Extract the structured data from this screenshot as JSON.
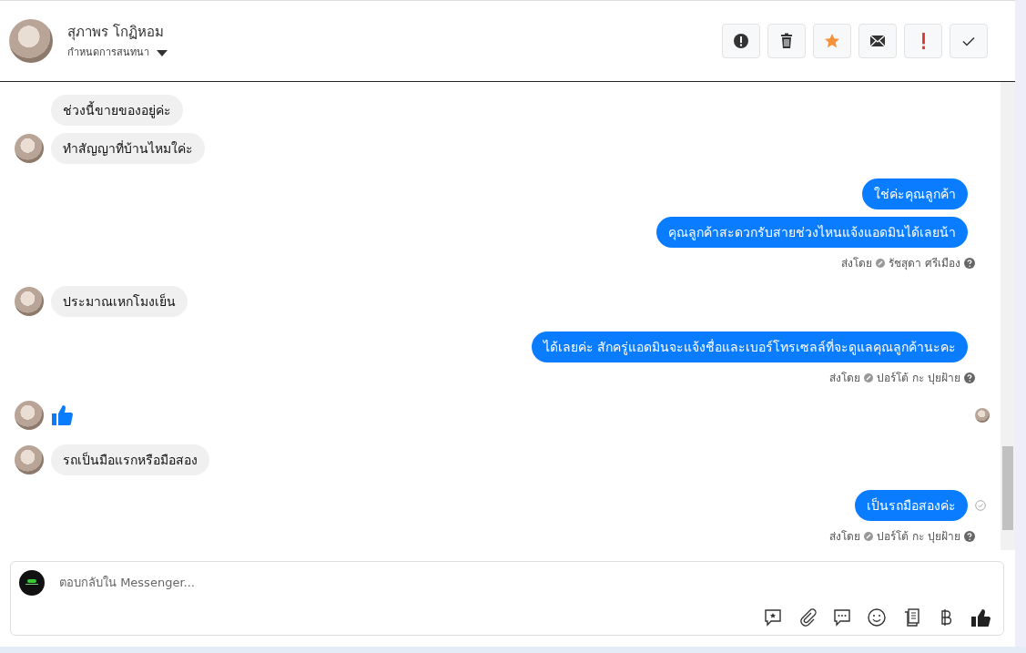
{
  "header": {
    "name": "สุภาพร โกฏิหอม",
    "subtitle": "กำหนดการสนทนา"
  },
  "groups": [
    {
      "kind": "incoming",
      "items": [
        {
          "kind": "text",
          "text": "ช่วงนี้ขายของอยู่ค่ะ"
        },
        {
          "kind": "text",
          "text": "ทำสัญญาที่บ้านไหมใค่ะ"
        }
      ]
    },
    {
      "kind": "outgoing",
      "items": [
        {
          "kind": "text",
          "text": "ใช่ค่ะคุณลูกค้า"
        },
        {
          "kind": "text",
          "text": "คุณลูกค้าสะดวกรับสายช่วงไหนแจ้งแอดมินได้เลยน้า"
        }
      ],
      "meta": {
        "label": "ส่งโดย",
        "sender": "รัชสุดา ศรีเมือง"
      }
    },
    {
      "kind": "incoming",
      "items": [
        {
          "kind": "text",
          "text": "ประมาณเหกโมงเย็น"
        }
      ]
    },
    {
      "kind": "outgoing",
      "items": [
        {
          "kind": "text",
          "text": "ได้เลยค่ะ สักครู่แอดมินจะแจ้งชื่อและเบอร์โทรเซลล์ที่จะดูแลคุณลูกค้านะคะ"
        }
      ],
      "meta": {
        "label": "ส่งโดย",
        "sender": "ปอร์โต้ กะ ปุยฝ้าย"
      }
    },
    {
      "kind": "incoming",
      "seen": true,
      "items": [
        {
          "kind": "like"
        }
      ]
    },
    {
      "kind": "incoming",
      "items": [
        {
          "kind": "text",
          "text": "รถเป็นมือแรกหรือมือสอง"
        }
      ]
    },
    {
      "kind": "outgoing",
      "read": true,
      "items": [
        {
          "kind": "text",
          "text": "เป็นรถมือสองค่ะ"
        }
      ],
      "meta": {
        "label": "ส่งโดย",
        "sender": "ปอร์โต้ กะ ปุยฝ้าย"
      }
    }
  ],
  "composer": {
    "placeholder": "ตอบกลับใน Messenger..."
  }
}
